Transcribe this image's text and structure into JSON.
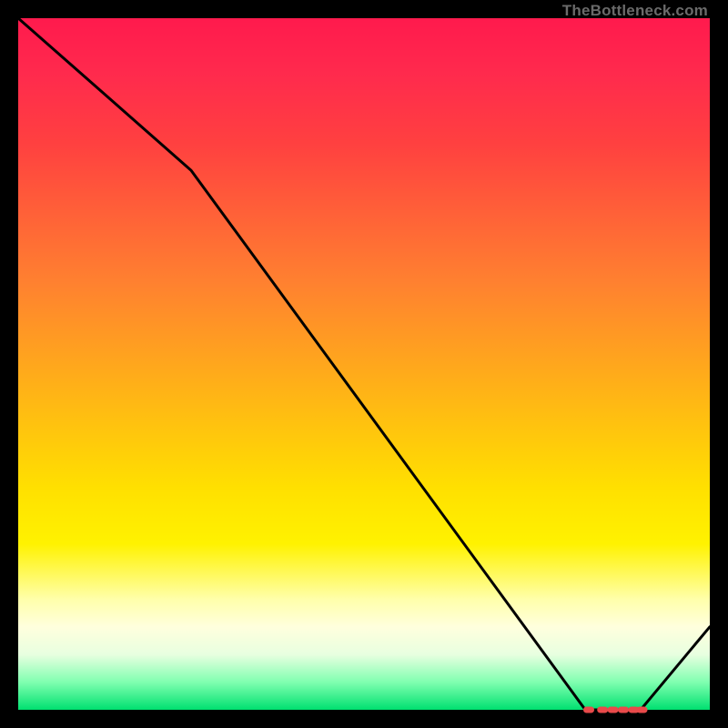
{
  "attribution": "TheBottleneck.com",
  "chart_data": {
    "type": "line",
    "title": "",
    "xlabel": "",
    "ylabel": "",
    "xlim": [
      0,
      100
    ],
    "ylim": [
      0,
      100
    ],
    "grid": false,
    "x": [
      0,
      25,
      82,
      90,
      100
    ],
    "y": [
      100,
      78,
      0,
      0,
      12
    ],
    "markers": {
      "shape": "rounded-dash",
      "color": "#e84a4a",
      "points_x": [
        82.5,
        84.5,
        86.0,
        87.5,
        89.0,
        90.2
      ],
      "points_y": [
        0,
        0,
        0,
        0,
        0,
        0
      ]
    }
  }
}
